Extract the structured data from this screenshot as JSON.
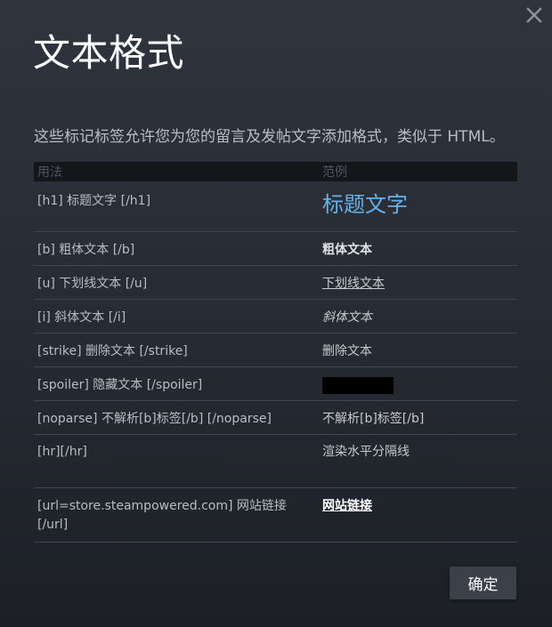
{
  "dialog": {
    "title": "文本格式",
    "description": "这些标记标签允许您为您的留言及发帖文字添加格式，类似于 HTML。",
    "close_icon": "close-icon",
    "confirm_label": "确定"
  },
  "table": {
    "headers": {
      "usage": "用法",
      "example": "范例"
    },
    "rows": [
      {
        "usage": "[h1] 标题文字 [/h1]",
        "example": "标题文字"
      },
      {
        "usage": "[b] 粗体文本 [/b]",
        "example": "粗体文本"
      },
      {
        "usage": "[u] 下划线文本 [/u]",
        "example": "下划线文本"
      },
      {
        "usage": "[i] 斜体文本 [/i]",
        "example": "斜体文本"
      },
      {
        "usage": "[strike] 删除文本 [/strike]",
        "example": "删除文本"
      },
      {
        "usage": "[spoiler] 隐藏文本 [/spoiler]",
        "example": ""
      },
      {
        "usage": "[noparse] 不解析[b]标签[/b] [/noparse]",
        "example": "不解析[b]标签[/b]"
      },
      {
        "usage": "[hr][/hr]",
        "example": "渲染水平分隔线"
      },
      {
        "usage": "[url=store.steampowered.com] 网站链接 [/url]",
        "example": "网站链接"
      }
    ]
  },
  "colors": {
    "heading_example": "#66b2e8",
    "button_bg": "#3b4049"
  }
}
